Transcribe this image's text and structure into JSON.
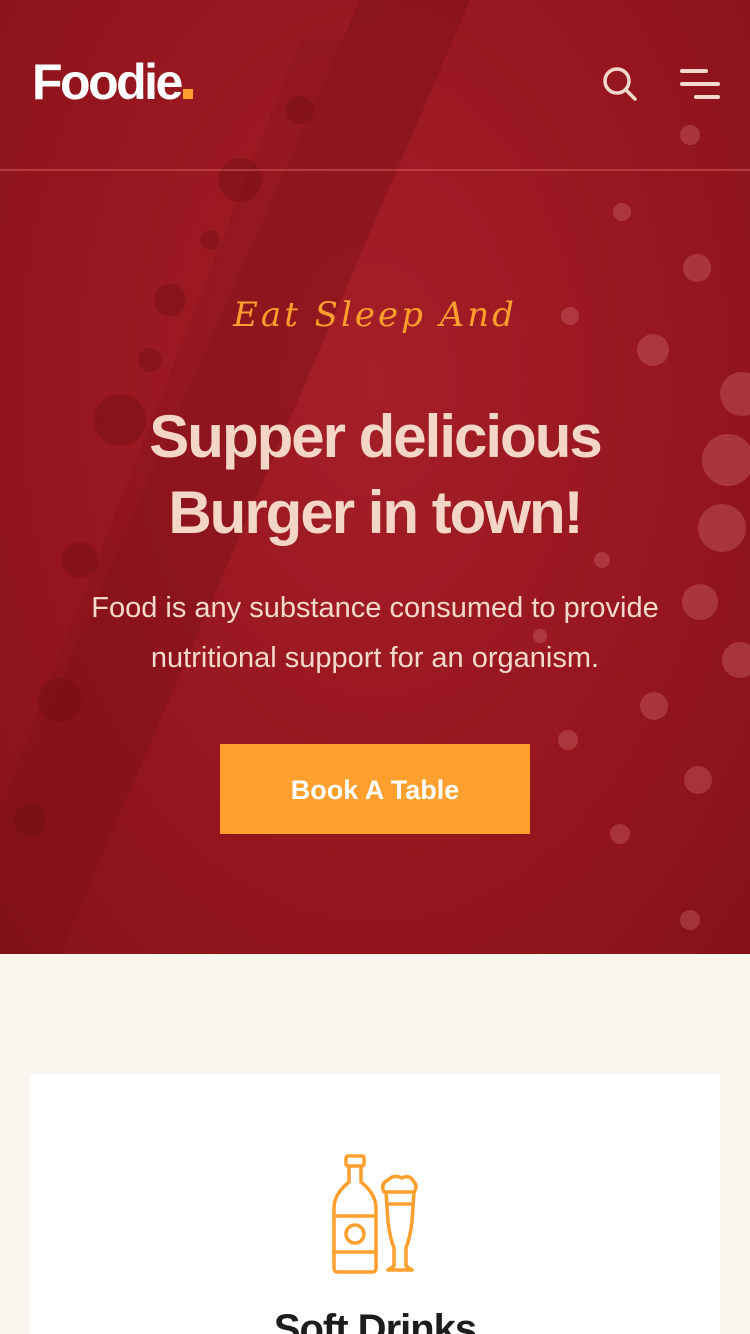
{
  "header": {
    "logo_text": "Foodie",
    "logo_accent": ".",
    "search_icon": "search-icon",
    "menu_icon": "menu-icon"
  },
  "hero": {
    "tagline": "Eat Sleep And",
    "headline_line1": "Supper delicious",
    "headline_line2": "Burger in town!",
    "description": "Food is any substance consumed to provide nutritional support for an organism.",
    "cta_label": "Book A Table"
  },
  "feature_card": {
    "icon": "drinks-icon",
    "title": "Soft Drinks"
  },
  "colors": {
    "hero_background": "#97161f",
    "accent": "#ff9f2e",
    "headline": "#f3d6c6",
    "page_background": "#f8f4ee",
    "card_background": "#ffffff",
    "card_title": "#1f1c1c"
  }
}
